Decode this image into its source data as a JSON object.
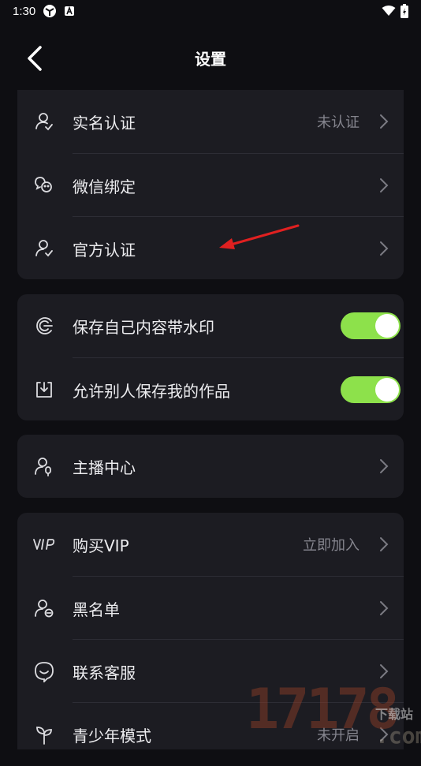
{
  "status_bar": {
    "time": "1:30"
  },
  "header": {
    "title": "设置"
  },
  "group1": [
    {
      "label": "实名认证",
      "value": "未认证",
      "icon": "user-verify-icon"
    },
    {
      "label": "微信绑定",
      "value": "",
      "icon": "wechat-icon"
    },
    {
      "label": "官方认证",
      "value": "",
      "icon": "official-verify-icon"
    }
  ],
  "group2": [
    {
      "label": "保存自己内容带水印",
      "icon": "watermark-icon",
      "on": true
    },
    {
      "label": "允许别人保存我的作品",
      "icon": "download-icon",
      "on": true
    }
  ],
  "group3": [
    {
      "label": "主播中心",
      "icon": "streamer-icon"
    }
  ],
  "group4": [
    {
      "label": "购买VIP",
      "value": "立即加入",
      "icon": "vip-icon"
    },
    {
      "label": "黑名单",
      "value": "",
      "icon": "blacklist-icon"
    },
    {
      "label": "联系客服",
      "value": "",
      "icon": "customer-service-icon"
    },
    {
      "label": "青少年模式",
      "value": "未开启",
      "icon": "sprout-icon"
    }
  ],
  "watermark": {
    "number": "17178",
    "suffix": ".com",
    "tag": "下载站"
  },
  "colors": {
    "background": "#0e0e12",
    "card": "#1c1c22",
    "toggle_on": "#8de14b",
    "annotation_arrow": "#e02020"
  }
}
